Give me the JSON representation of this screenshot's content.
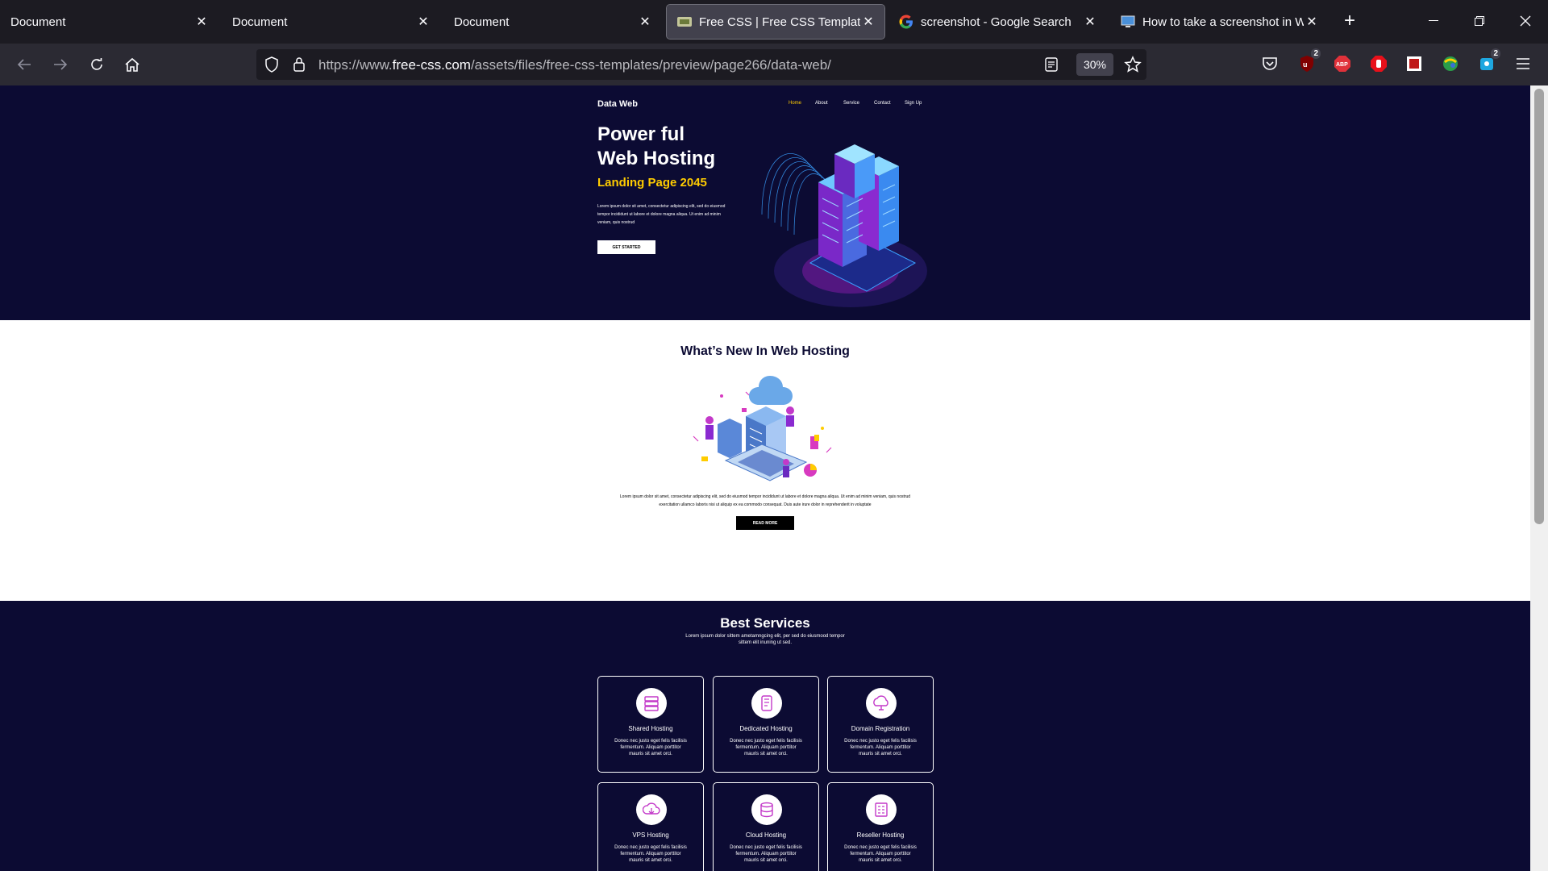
{
  "tabs": [
    {
      "title": "Document"
    },
    {
      "title": "Document"
    },
    {
      "title": "Document"
    },
    {
      "title": "Free CSS | Free CSS Templates"
    },
    {
      "title": "screenshot - Google Search"
    },
    {
      "title": "How to take a screenshot in W"
    }
  ],
  "url": {
    "prefix": "https://www.",
    "domain": "free-css.com",
    "path": "/assets/files/free-css-templates/preview/page266/data-web/"
  },
  "zoom": "30%",
  "extension_badges": {
    "ublock": "2",
    "notif": "2"
  },
  "extension_labels": {
    "abp": "ABP"
  },
  "site": {
    "logo": "Data Web",
    "nav": [
      "Home",
      "About",
      "Service",
      "Contact",
      "Sign Up"
    ],
    "hero": {
      "title_line1": "Power ful",
      "title_line2": "Web Hosting",
      "subtitle": "Landing Page 2045",
      "text": "Lorem ipsum dolor sit amet, consectetur adipiscing elit, sed do eiusmod tempor incididunt ut labore et dolore magna aliqua. Ut enim ad minim veniam, quis nostrud",
      "button": "GET STARTED"
    },
    "about": {
      "title": "What’s New In Web Hosting",
      "text": "Lorem ipsum dolor sit amet, consectetur adipiscing elit, sed do eiusmod tempor incididunt ut labore et dolore magna aliqua. Ut enim ad minim veniam, quis nostrud exercitation ullamco laboris nisi ut aliquip ex ea commodo consequat. Duis aute irure dolor in reprehenderit in voluptate",
      "button": "READ MORE"
    },
    "services": {
      "title": "Best Services",
      "subtitle": "Lorem ipsum dolor sittem ametamngcing elit, per sed do eiusmood tempor sittem elit inuning ut sed.",
      "cards": [
        {
          "title": "Shared Hosting",
          "text": "Donec nec justo eget felis facilisis fermentum. Aliquam porttitor mauris sit amet orci."
        },
        {
          "title": "Dedicated Hosting",
          "text": "Donec nec justo eget felis facilisis fermentum. Aliquam porttitor mauris sit amet orci."
        },
        {
          "title": "Domain Registration",
          "text": "Donec nec justo eget felis facilisis fermentum. Aliquam porttitor mauris sit amet orci."
        },
        {
          "title": "VPS Hosting",
          "text": "Donec nec justo eget felis facilisis fermentum. Aliquam porttitor mauris sit amet orci."
        },
        {
          "title": "Cloud Hosting",
          "text": "Donec nec justo eget felis facilisis fermentum. Aliquam porttitor mauris sit amet orci."
        },
        {
          "title": "Reseller Hosting",
          "text": "Donec nec justo eget felis facilisis fermentum. Aliquam porttitor mauris sit amet orci."
        }
      ]
    }
  },
  "colors": {
    "hero_bg": "#0c0b33",
    "accent_yellow": "#ffcc00",
    "icon_magenta": "#c339c9",
    "chrome_dark": "#1c1b22"
  }
}
